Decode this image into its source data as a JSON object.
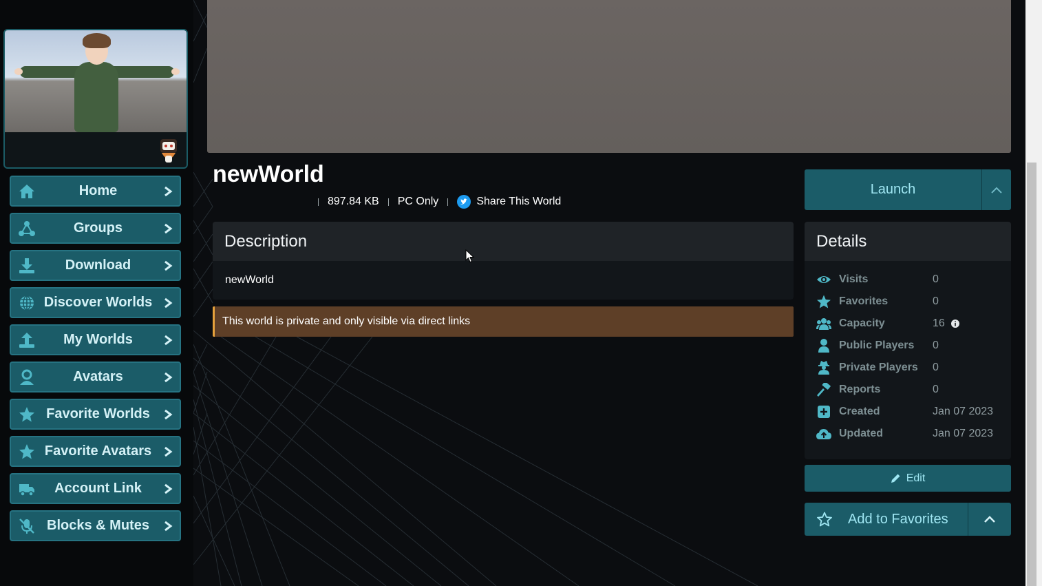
{
  "sidebar": {
    "items": [
      {
        "label": "Home",
        "icon": "home-icon"
      },
      {
        "label": "Groups",
        "icon": "groups-icon"
      },
      {
        "label": "Download",
        "icon": "download-icon"
      },
      {
        "label": "Discover Worlds",
        "icon": "globe-icon"
      },
      {
        "label": "My Worlds",
        "icon": "upload-icon"
      },
      {
        "label": "Avatars",
        "icon": "avatar-icon"
      },
      {
        "label": "Favorite Worlds",
        "icon": "star-icon"
      },
      {
        "label": "Favorite Avatars",
        "icon": "star-icon"
      },
      {
        "label": "Account Link",
        "icon": "truck-icon"
      },
      {
        "label": "Blocks & Mutes",
        "icon": "mute-icon"
      }
    ]
  },
  "world": {
    "title": "newWorld",
    "size": "897.84 KB",
    "platform": "PC Only",
    "share_label": "Share This World",
    "description_heading": "Description",
    "description": "newWorld",
    "private_notice": "This world is private and only visible via direct links"
  },
  "actions": {
    "launch_label": "Launch",
    "edit_label": "Edit",
    "favorite_label": "Add to Favorites"
  },
  "details": {
    "heading": "Details",
    "rows": [
      {
        "label": "Visits",
        "value": "0",
        "icon": "eye-icon"
      },
      {
        "label": "Favorites",
        "value": "0",
        "icon": "star-icon"
      },
      {
        "label": "Capacity",
        "value": "16",
        "icon": "users-icon"
      },
      {
        "label": "Public Players",
        "value": "0",
        "icon": "user-icon"
      },
      {
        "label": "Private Players",
        "value": "0",
        "icon": "user-secret-icon"
      },
      {
        "label": "Reports",
        "value": "0",
        "icon": "gavel-icon"
      },
      {
        "label": "Created",
        "value": "Jan 07 2023",
        "icon": "plus-square-icon"
      },
      {
        "label": "Updated",
        "value": "Jan 07 2023",
        "icon": "cloud-upload-icon"
      }
    ]
  },
  "colors": {
    "accent": "#1b5c68",
    "accent_text": "#9fe6f2",
    "icon_teal": "#4fb8c7",
    "warning_bg": "#5e3f27",
    "warning_border": "#e6a23c"
  }
}
